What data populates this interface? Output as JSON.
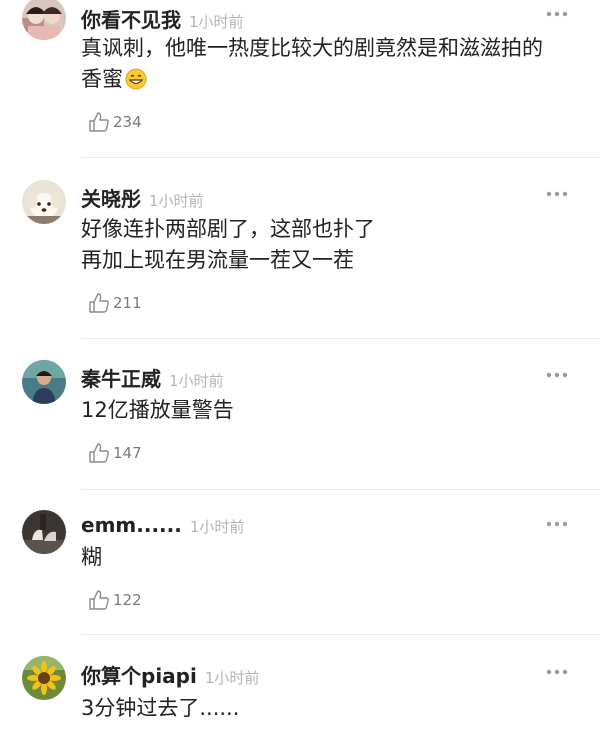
{
  "comments": [
    {
      "username": "你看不见我",
      "time": "1小时前",
      "text_lines": [
        "真讽刺，他唯一热度比较大的剧竟然是和滋滋拍的",
        "香蜜"
      ],
      "likes": "234",
      "avatar_icon": "portrait-icon",
      "trailing_emoji": "grinning-face-emoji"
    },
    {
      "username": "关晓彤",
      "time": "1小时前",
      "text_lines": [
        "好像连扑两部剧了，这部也扑了",
        "再加上现在男流量一茬又一茬"
      ],
      "likes": "211",
      "avatar_icon": "dog-icon"
    },
    {
      "username": "秦牛正威",
      "time": "1小时前",
      "text_lines": [
        "12亿播放量警告"
      ],
      "likes": "147",
      "avatar_icon": "person-icon"
    },
    {
      "username": "emm......",
      "time": "1小时前",
      "text_lines": [
        "糊"
      ],
      "likes": "122",
      "avatar_icon": "shoes-icon"
    },
    {
      "username": "你算个piapi",
      "time": "1小时前",
      "text_lines": [
        "3分钟过去了......"
      ],
      "likes": "",
      "avatar_icon": "sunflower-icon"
    }
  ],
  "colors": {
    "text": "#222222",
    "timestamp": "#b4b4b4",
    "like_count": "#7a7a7a",
    "divider": "#ececec",
    "more_dots": "#9a9a9a"
  }
}
